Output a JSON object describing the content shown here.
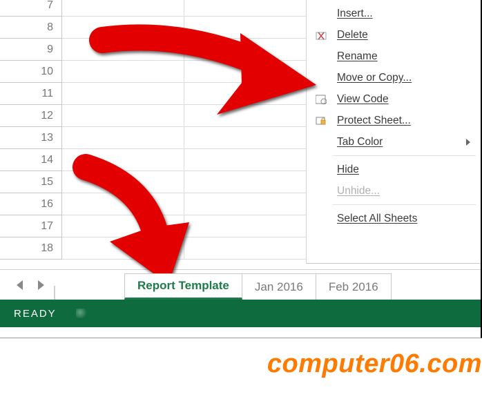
{
  "rows": [
    "7",
    "8",
    "9",
    "10",
    "11",
    "12",
    "13",
    "14",
    "15",
    "16",
    "17",
    "18"
  ],
  "menu": {
    "insert": "Insert...",
    "delete": "Delete",
    "rename": "Rename",
    "move": "Move or Copy...",
    "viewcode": "View Code",
    "protect": "Protect Sheet...",
    "tabcolor": "Tab Color",
    "hide": "Hide",
    "unhide": "Unhide...",
    "selectall": "Select All Sheets"
  },
  "tabs": {
    "active": "Report Template",
    "t1": "Jan 2016",
    "t2": "Feb 2016"
  },
  "status": {
    "ready": "READY"
  },
  "watermark": "computer06.com"
}
